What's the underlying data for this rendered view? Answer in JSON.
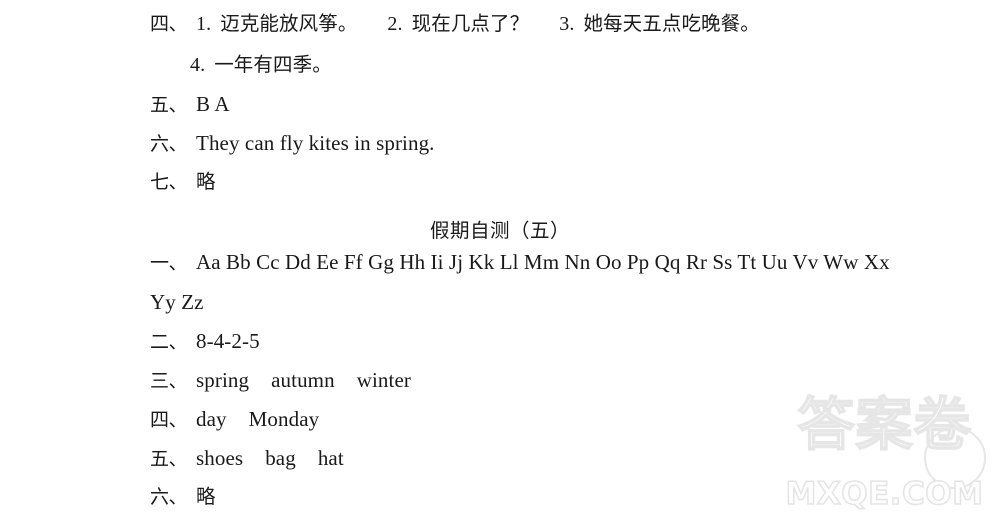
{
  "page": {
    "background_color": "#ffffff",
    "text_color": "#1a1a1a"
  },
  "block_previous": {
    "items": [
      {
        "marker": "四、",
        "sub_items": [
          {
            "number": "1.",
            "text": "迈克能放风筝。"
          },
          {
            "number": "2.",
            "text": "现在几点了？"
          },
          {
            "number": "3.",
            "text": "她每天五点吃晚餐。"
          }
        ]
      },
      {
        "marker": "",
        "sub_items": [
          {
            "number": "4.",
            "text": "一年有四季。"
          }
        ]
      },
      {
        "marker": "五、",
        "text": "B A"
      },
      {
        "marker": "六、",
        "text": "They can fly kites in spring."
      },
      {
        "marker": "七、",
        "text": "略"
      }
    ]
  },
  "section": {
    "title": "假期自测（五）",
    "items": [
      {
        "marker": "一、",
        "text_line1": "Aa Bb Cc Dd Ee Ff Gg Hh Ii Jj Kk Ll Mm Nn Oo Pp Qq Rr Ss Tt Uu Vv Ww Xx",
        "text_line2": "Yy Zz"
      },
      {
        "marker": "二、",
        "text": "8-4-2-5"
      },
      {
        "marker": "三、",
        "words": [
          "spring",
          "autumn",
          "winter"
        ]
      },
      {
        "marker": "四、",
        "words": [
          "day",
          "Monday"
        ]
      },
      {
        "marker": "五、",
        "words": [
          "shoes",
          "bag",
          "hat"
        ]
      },
      {
        "marker": "六、",
        "text": "略"
      }
    ]
  },
  "watermark": {
    "chinese": "答案卷",
    "chinese_main": "答案",
    "chinese_circled": "卷",
    "domain": "MXQE.COM",
    "color": "#e6e6e6"
  }
}
